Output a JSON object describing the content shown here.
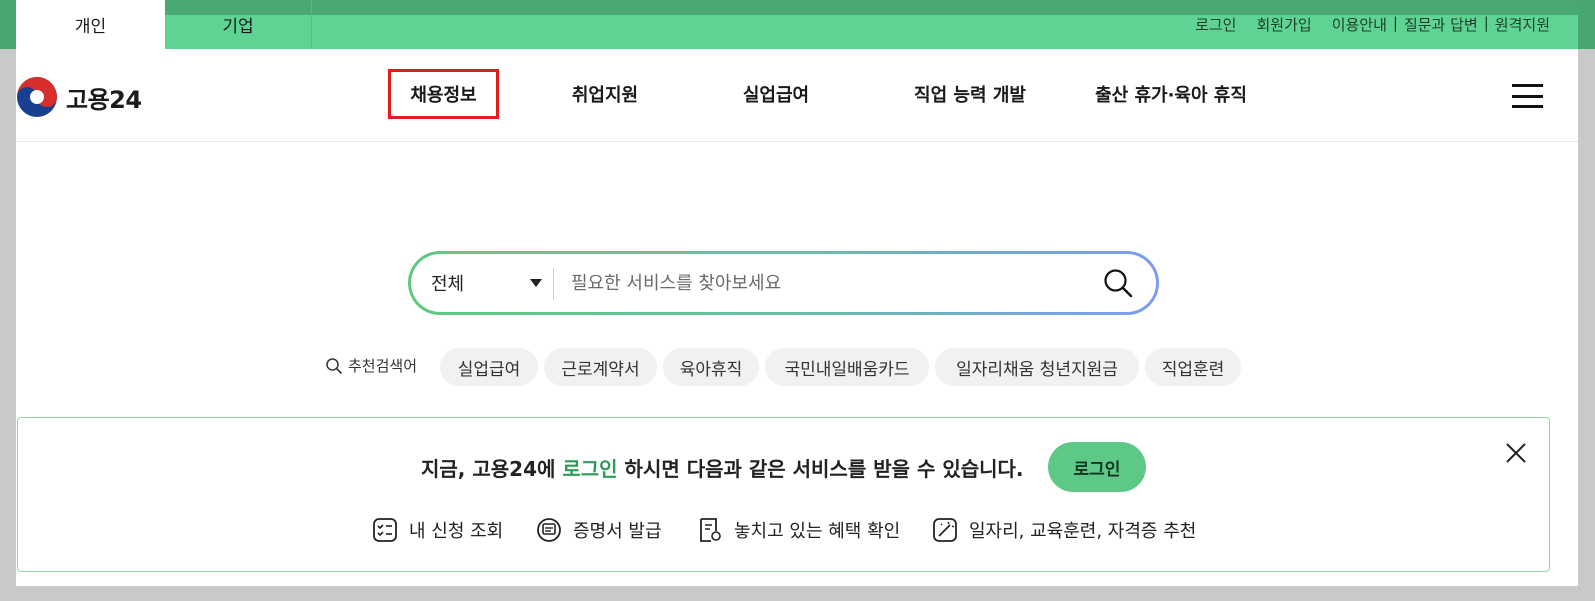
{
  "topbar": {
    "tabs": [
      "개인",
      "기업"
    ],
    "links": [
      "로그인",
      "회원가입",
      "이용안내",
      "질문과 답변",
      "원격지원"
    ],
    "separator": "|"
  },
  "header": {
    "logo_text": "고용24",
    "nav": [
      "채용정보",
      "취업지원",
      "실업급여",
      "직업 능력 개발",
      "출산 휴가·육아 휴직"
    ],
    "menu_icon": "hamburger-icon"
  },
  "search": {
    "scope_value": "전체",
    "placeholder": "필요한 서비스를 찾아보세요",
    "icon": "search-icon"
  },
  "recommended": {
    "label": "추천검색어",
    "keywords": [
      "실업급여",
      "근로계약서",
      "육아휴직",
      "국민내일배움카드",
      "일자리채움 청년지원금",
      "직업훈련"
    ]
  },
  "login_notice": {
    "message_before": "지금, 고용24에",
    "message_highlight": "로그인",
    "message_after": "하시면 다음과 같은 서비스를 받을 수 있습니다.",
    "login_button": "로그인",
    "services": [
      "내 신청 조회",
      "증명서 발급",
      "놓치고 있는 혜택 확인",
      "일자리, 교육훈련, 자격증 추천"
    ]
  },
  "colors": {
    "top_bar": "#5fd393",
    "accent_green": "#2e9b58",
    "nav_highlight_border": "#e01e1e"
  }
}
